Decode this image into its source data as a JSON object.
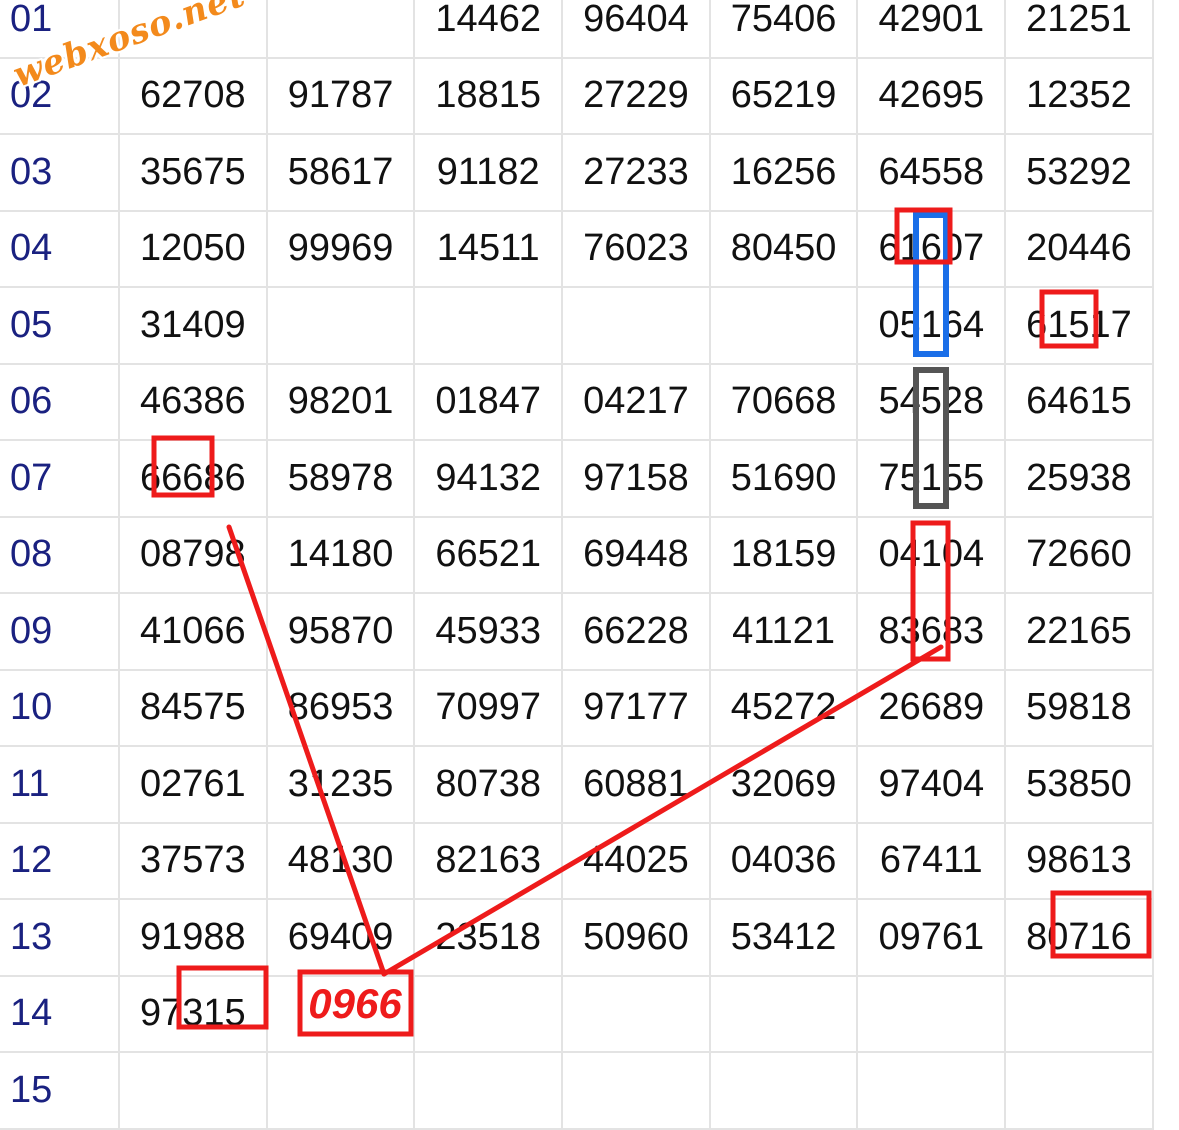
{
  "watermark": "webxoso.net",
  "annotation": "0966",
  "rows": [
    {
      "label": "01",
      "cells": [
        "",
        "",
        "14462",
        "96404",
        "75406",
        "42901",
        "21251"
      ]
    },
    {
      "label": "02",
      "cells": [
        "62708",
        "91787",
        "18815",
        "27229",
        "65219",
        "42695",
        "12352"
      ]
    },
    {
      "label": "03",
      "cells": [
        "35675",
        "58617",
        "91182",
        "27233",
        "16256",
        "64558",
        "53292"
      ]
    },
    {
      "label": "04",
      "cells": [
        "12050",
        "99969",
        "14511",
        "76023",
        "80450",
        "61607",
        "20446"
      ]
    },
    {
      "label": "05",
      "cells": [
        "31409",
        "",
        "",
        "",
        "",
        "05164",
        "61517"
      ]
    },
    {
      "label": "06",
      "cells": [
        "46386",
        "98201",
        "01847",
        "04217",
        "70668",
        "54528",
        "64615"
      ]
    },
    {
      "label": "07",
      "cells": [
        "66686",
        "58978",
        "94132",
        "97158",
        "51690",
        "75155",
        "25938"
      ]
    },
    {
      "label": "08",
      "cells": [
        "08798",
        "14180",
        "66521",
        "69448",
        "18159",
        "04104",
        "72660"
      ]
    },
    {
      "label": "09",
      "cells": [
        "41066",
        "95870",
        "45933",
        "66228",
        "41121",
        "83683",
        "22165"
      ]
    },
    {
      "label": "10",
      "cells": [
        "84575",
        "86953",
        "70997",
        "97177",
        "45272",
        "26689",
        "59818"
      ]
    },
    {
      "label": "11",
      "cells": [
        "02761",
        "31235",
        "80738",
        "60881",
        "32069",
        "97404",
        "53850"
      ]
    },
    {
      "label": "12",
      "cells": [
        "37573",
        "48130",
        "82163",
        "44025",
        "04036",
        "67411",
        "98613"
      ]
    },
    {
      "label": "13",
      "cells": [
        "91988",
        "69409",
        "23518",
        "50960",
        "53412",
        "09761",
        "80716"
      ]
    },
    {
      "label": "14",
      "cells": [
        "97315",
        "",
        "",
        "",
        "",
        "",
        ""
      ]
    },
    {
      "label": "15",
      "cells": [
        "",
        "",
        "",
        "",
        "",
        "",
        ""
      ]
    }
  ],
  "colors": {
    "red": "#ee1b1b",
    "blue": "#1a6ee8",
    "gray": "#555555",
    "label": "#1a2180"
  }
}
